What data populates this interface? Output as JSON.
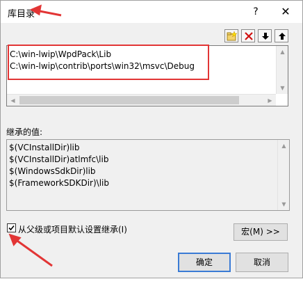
{
  "window": {
    "title": "库目录",
    "help_label": "?",
    "close_label": "✕"
  },
  "toolbar": {
    "buttons": [
      "new-folder-icon",
      "delete-icon",
      "move-down-icon",
      "move-up-icon"
    ]
  },
  "directories": [
    "C:\\win-lwip\\WpdPack\\Lib",
    "C:\\win-lwip\\contrib\\ports\\win32\\msvc\\Debug"
  ],
  "inherited": {
    "label": "继承的值:",
    "values": [
      "$(VCInstallDir)lib",
      "$(VCInstallDir)atlmfc\\lib",
      "$(WindowsSdkDir)lib",
      "$(FrameworkSDKDir)\\lib"
    ]
  },
  "inherit_checkbox": {
    "label": "从父级或项目默认设置继承(I)",
    "checked": true
  },
  "buttons": {
    "macro": "宏(M) >>",
    "ok": "确定",
    "cancel": "取消"
  },
  "colors": {
    "highlight_red": "#e23535",
    "default_button_border": "#3a7bd5"
  }
}
